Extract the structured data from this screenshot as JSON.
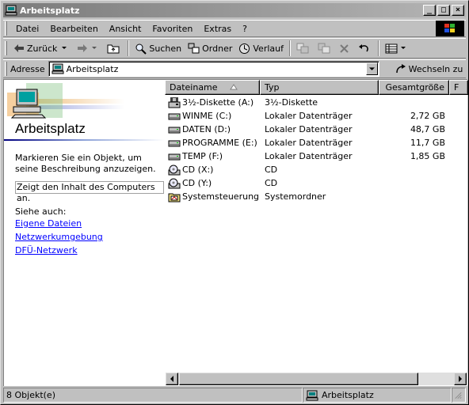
{
  "window": {
    "title": "Arbeitsplatz",
    "buttons": [
      "_",
      "□",
      "×"
    ]
  },
  "menu": [
    "Datei",
    "Bearbeiten",
    "Ansicht",
    "Favoriten",
    "Extras",
    "?"
  ],
  "toolbar": {
    "back": "Zurück",
    "search": "Suchen",
    "folders": "Ordner",
    "history": "Verlauf"
  },
  "address": {
    "label": "Adresse",
    "value": "Arbeitsplatz",
    "go": "Wechseln zu"
  },
  "left_pane": {
    "title": "Arbeitsplatz",
    "description": "Markieren Sie ein Objekt, um seine Beschreibung anzuzeigen.",
    "info": "Zeigt den Inhalt des Computers an.",
    "see_also": "Siehe auch:",
    "links": [
      "Eigene Dateien",
      "Netzwerkumgebung",
      "DFÜ-Netzwerk"
    ]
  },
  "columns": [
    "Dateiname",
    "Typ",
    "Gesamtgröße",
    "F"
  ],
  "items": [
    {
      "name": "3½-Diskette (A:)",
      "type": "3½-Diskette",
      "size": "",
      "icon": "floppy-icon"
    },
    {
      "name": "WINME (C:)",
      "type": "Lokaler Datenträger",
      "size": "2,72 GB",
      "icon": "harddisk-icon"
    },
    {
      "name": "DATEN (D:)",
      "type": "Lokaler Datenträger",
      "size": "48,7 GB",
      "icon": "harddisk-icon"
    },
    {
      "name": "PROGRAMME (E:)",
      "type": "Lokaler Datenträger",
      "size": "11,7 GB",
      "icon": "harddisk-icon"
    },
    {
      "name": "TEMP (F:)",
      "type": "Lokaler Datenträger",
      "size": "1,85 GB",
      "icon": "harddisk-icon"
    },
    {
      "name": "CD (X:)",
      "type": "CD",
      "size": "",
      "icon": "cd-drive-icon"
    },
    {
      "name": "CD (Y:)",
      "type": "CD",
      "size": "",
      "icon": "cd-drive-icon"
    },
    {
      "name": "Systemsteuerung",
      "type": "Systemordner",
      "size": "",
      "icon": "control-panel-icon"
    }
  ],
  "status": {
    "count": "8 Objekt(e)",
    "location": "Arbeitsplatz"
  }
}
